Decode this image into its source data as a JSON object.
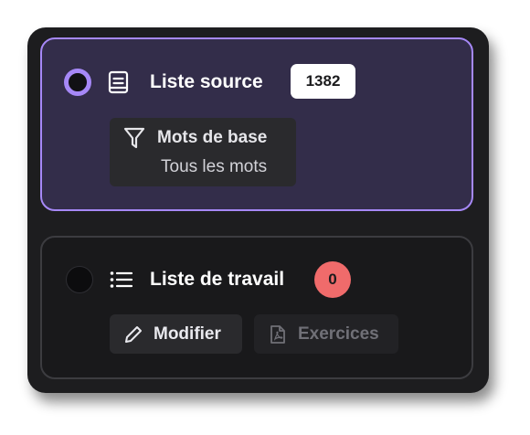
{
  "source_list": {
    "title": "Liste source",
    "count": "1382",
    "selected": true,
    "filter": {
      "title": "Mots de base",
      "value": "Tous les mots"
    },
    "icon": "book-icon"
  },
  "work_list": {
    "title": "Liste de travail",
    "count": "0",
    "selected": false,
    "icon": "list-icon",
    "buttons": {
      "modify": "Modifier",
      "exercises": "Exercices"
    }
  },
  "colors": {
    "accent": "#a688f7",
    "selected_card": "#332d4a",
    "panel": "#1d1d1f",
    "count_badge_zero": "#f06b6b"
  }
}
